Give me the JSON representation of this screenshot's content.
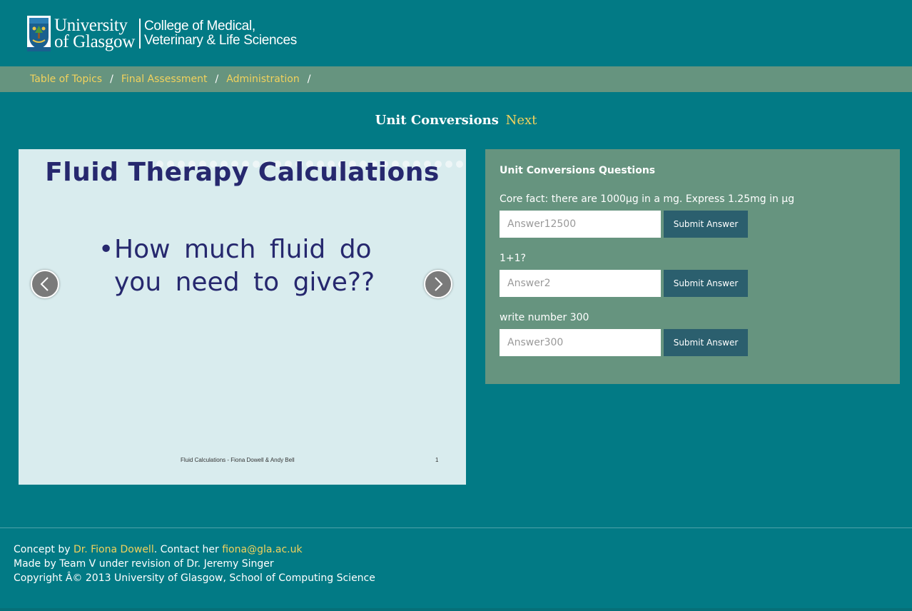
{
  "header": {
    "university_line1": "University",
    "university_line2": "of Glasgow",
    "college_line1": "College of Medical,",
    "college_line2": "Veterinary & Life Sciences"
  },
  "breadcrumb": [
    {
      "label": "Table of Topics"
    },
    {
      "label": "Final Assessment"
    },
    {
      "label": "Administration"
    }
  ],
  "breadcrumb_sep": "/",
  "page": {
    "title": "Unit Conversions",
    "next_label": "Next"
  },
  "slide": {
    "title": "Fluid Therapy Calculations",
    "bullet": "•",
    "bullet_text": "How much fluid do you need to give??",
    "footer": "Fluid Calculations - Fiona Dowell & Andy Bell",
    "number": "1",
    "dot_count": 29,
    "active_dot": 17
  },
  "questions_panel": {
    "heading": "Unit Conversions Questions",
    "questions": [
      {
        "label": "Core fact: there are 1000µg in a mg. Express 1.25mg in µg",
        "placeholder": "Answer12500",
        "button": "Submit Answer"
      },
      {
        "label": "1+1?",
        "placeholder": "Answer2",
        "button": "Submit Answer"
      },
      {
        "label": "write number 300",
        "placeholder": "Answer300",
        "button": "Submit Answer"
      }
    ]
  },
  "footer": {
    "concept_prefix": "Concept by ",
    "concept_name": "Dr. Fiona Dowell",
    "contact_prefix": ". Contact her ",
    "contact_email": "fiona@gla.ac.uk",
    "made_by": "Made by Team V under revision of Dr. Jeremy Singer",
    "copyright": "Copyright Â© 2013 University of Glasgow, School of Computing Science"
  },
  "colors": {
    "background": "#027a85",
    "breadcrumb_bar": "#66947f",
    "link": "#f2d25c",
    "slide_text": "#26286e",
    "button": "#2b5f6e"
  }
}
